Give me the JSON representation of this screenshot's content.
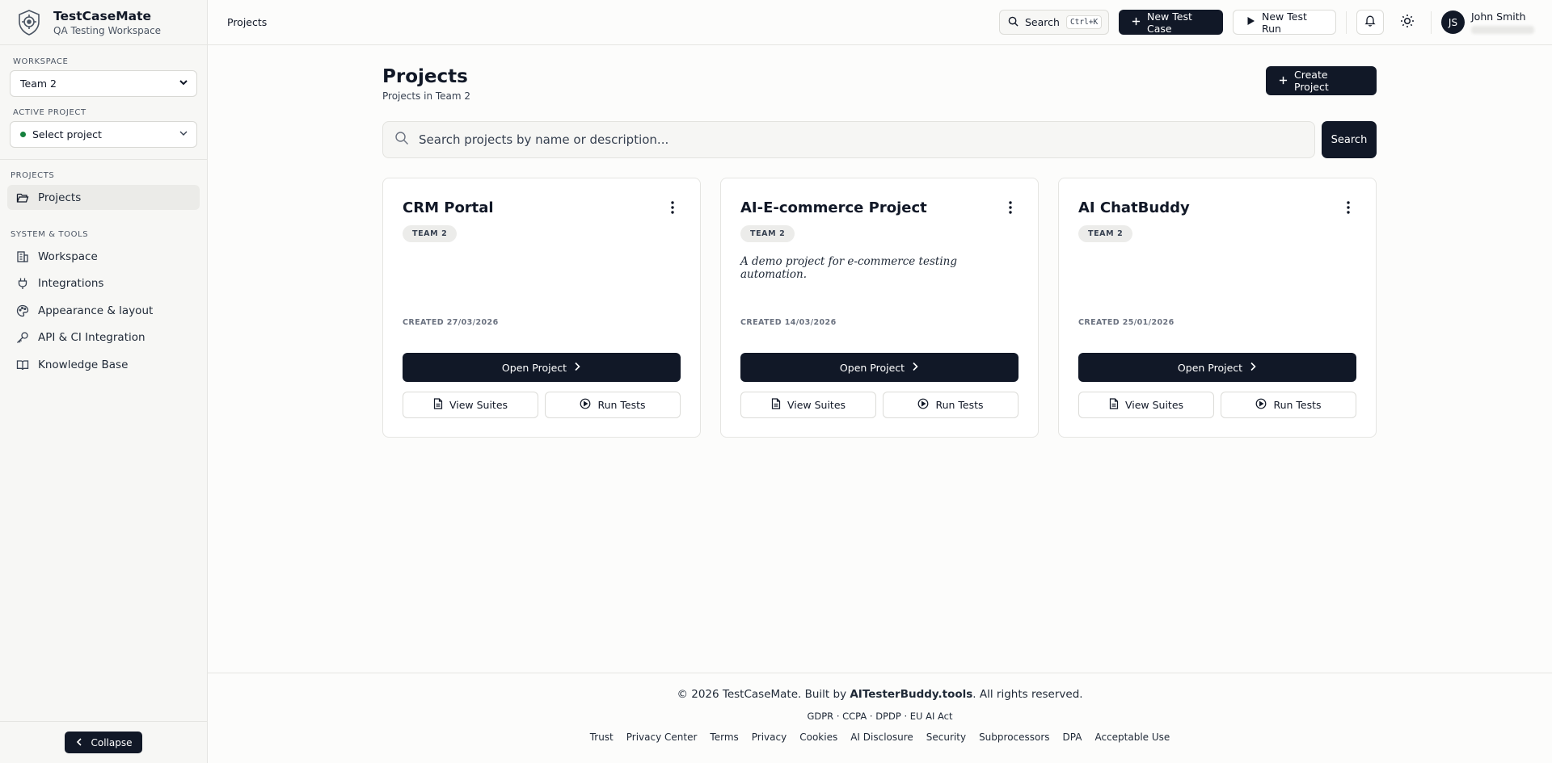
{
  "brand": {
    "name": "TestCaseMate",
    "subtitle": "QA Testing Workspace"
  },
  "sidebar": {
    "workspace_label": "WORKSPACE",
    "workspace_value": "Team 2",
    "active_project_label": "ACTIVE PROJECT",
    "active_project_value": "Select project",
    "projects_label": "PROJECTS",
    "projects_item": "Projects",
    "system_label": "SYSTEM & TOOLS",
    "tools": [
      {
        "label": "Workspace",
        "icon": "building-icon"
      },
      {
        "label": "Integrations",
        "icon": "plug-icon"
      },
      {
        "label": "Appearance & layout",
        "icon": "palette-icon"
      },
      {
        "label": "API & CI Integration",
        "icon": "key-icon"
      },
      {
        "label": "Knowledge Base",
        "icon": "book-icon"
      }
    ],
    "collapse_label": "Collapse"
  },
  "topbar": {
    "breadcrumb": "Projects",
    "search_label": "Search",
    "search_shortcut": "Ctrl+K",
    "new_test_case": "New Test Case",
    "new_test_run": "New Test Run",
    "user_name": "John Smith",
    "user_initials": "JS"
  },
  "page": {
    "title": "Projects",
    "subtitle": "Projects in Team 2",
    "create_button": "Create Project",
    "search_placeholder": "Search projects by name or description...",
    "search_button": "Search"
  },
  "projects": [
    {
      "name": "CRM Portal",
      "team": "TEAM 2",
      "description": "",
      "created": "CREATED 27/03/2026",
      "open": "Open Project",
      "suites": "View Suites",
      "run": "Run Tests"
    },
    {
      "name": "AI-E-commerce Project",
      "team": "TEAM 2",
      "description": "A demo project for e-commerce testing automation.",
      "created": "CREATED 14/03/2026",
      "open": "Open Project",
      "suites": "View Suites",
      "run": "Run Tests"
    },
    {
      "name": "AI ChatBuddy",
      "team": "TEAM 2",
      "description": "",
      "created": "CREATED 25/01/2026",
      "open": "Open Project",
      "suites": "View Suites",
      "run": "Run Tests"
    }
  ],
  "footer": {
    "copy_prefix": "© 2026 TestCaseMate. Built by ",
    "copy_brand": "AITesterBuddy.tools",
    "copy_suffix": ". All rights reserved.",
    "compliance": "GDPR · CCPA · DPDP · EU AI Act",
    "links": [
      "Trust",
      "Privacy Center",
      "Terms",
      "Privacy",
      "Cookies",
      "AI Disclosure",
      "Security",
      "Subprocessors",
      "DPA",
      "Acceptable Use"
    ]
  }
}
